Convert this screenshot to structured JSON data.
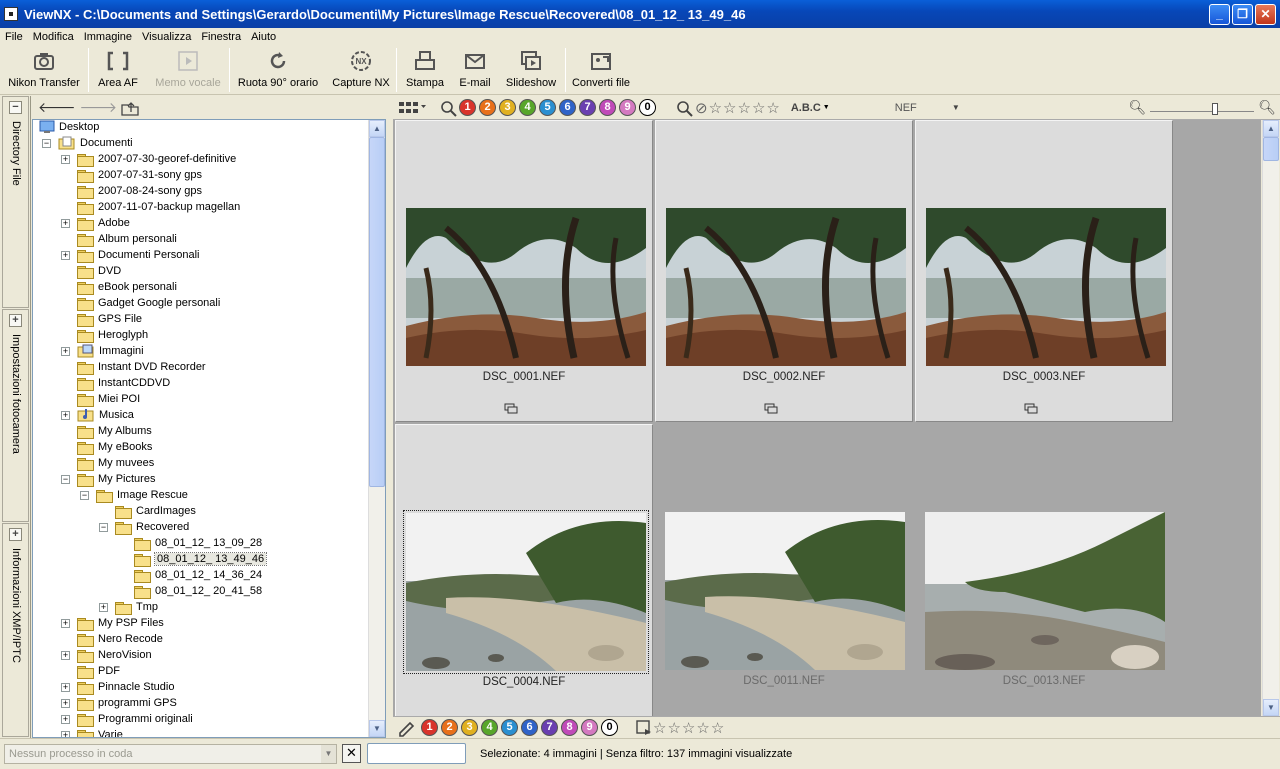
{
  "window": {
    "title": "ViewNX - C:\\Documents and Settings\\Gerardo\\Documenti\\My Pictures\\Image Rescue\\Recovered\\08_01_12_ 13_49_46",
    "buttons": {
      "minimize": "_",
      "maximize": "❐",
      "close": "✕"
    }
  },
  "menu": [
    "File",
    "Modifica",
    "Immagine",
    "Visualizza",
    "Finestra",
    "Aiuto"
  ],
  "toolbar": {
    "nikon_transfer": "Nikon Transfer",
    "area_af": "Area AF",
    "memo_vocale": "Memo vocale",
    "ruota": "Ruota 90° orario",
    "capture_nx": "Capture NX",
    "stampa": "Stampa",
    "email": "E-mail",
    "slideshow": "Slideshow",
    "converti": "Converti file"
  },
  "side_tabs": [
    "Directory File",
    "Impostazioni fotocamera",
    "Informazioni XMP/IPTC"
  ],
  "tree": {
    "rows": [
      {
        "label": "Desktop",
        "level": 0,
        "expander": "",
        "icon": "desktop"
      },
      {
        "label": "Documenti",
        "level": 1,
        "expander": "−",
        "icon": "docs"
      },
      {
        "label": "2007-07-30-georef-definitive",
        "level": 2,
        "expander": "+",
        "icon": "folder"
      },
      {
        "label": "2007-07-31-sony gps",
        "level": 2,
        "expander": "",
        "icon": "folder"
      },
      {
        "label": "2007-08-24-sony gps",
        "level": 2,
        "expander": "",
        "icon": "folder"
      },
      {
        "label": "2007-11-07-backup magellan",
        "level": 2,
        "expander": "",
        "icon": "folder"
      },
      {
        "label": "Adobe",
        "level": 2,
        "expander": "+",
        "icon": "folder"
      },
      {
        "label": "Album personali",
        "level": 2,
        "expander": "",
        "icon": "folder"
      },
      {
        "label": "Documenti Personali",
        "level": 2,
        "expander": "+",
        "icon": "folder"
      },
      {
        "label": "DVD",
        "level": 2,
        "expander": "",
        "icon": "folder"
      },
      {
        "label": "eBook personali",
        "level": 2,
        "expander": "",
        "icon": "folder"
      },
      {
        "label": "Gadget Google personali",
        "level": 2,
        "expander": "",
        "icon": "folder"
      },
      {
        "label": "GPS File",
        "level": 2,
        "expander": "",
        "icon": "folder"
      },
      {
        "label": "Heroglyph",
        "level": 2,
        "expander": "",
        "icon": "folder"
      },
      {
        "label": "Immagini",
        "level": 2,
        "expander": "+",
        "icon": "pictures"
      },
      {
        "label": "Instant DVD Recorder",
        "level": 2,
        "expander": "",
        "icon": "folder"
      },
      {
        "label": "InstantCDDVD",
        "level": 2,
        "expander": "",
        "icon": "folder"
      },
      {
        "label": "Miei POI",
        "level": 2,
        "expander": "",
        "icon": "folder"
      },
      {
        "label": "Musica",
        "level": 2,
        "expander": "+",
        "icon": "music"
      },
      {
        "label": "My Albums",
        "level": 2,
        "expander": "",
        "icon": "folder"
      },
      {
        "label": "My eBooks",
        "level": 2,
        "expander": "",
        "icon": "folder"
      },
      {
        "label": "My muvees",
        "level": 2,
        "expander": "",
        "icon": "folder"
      },
      {
        "label": "My Pictures",
        "level": 2,
        "expander": "−",
        "icon": "folder"
      },
      {
        "label": "Image Rescue",
        "level": 3,
        "expander": "−",
        "icon": "folder"
      },
      {
        "label": "CardImages",
        "level": 4,
        "expander": "",
        "icon": "folder"
      },
      {
        "label": "Recovered",
        "level": 4,
        "expander": "−",
        "icon": "folder"
      },
      {
        "label": "08_01_12_ 13_09_28",
        "level": 5,
        "expander": "",
        "icon": "folder"
      },
      {
        "label": "08_01_12_ 13_49_46",
        "level": 5,
        "expander": "",
        "icon": "folder",
        "selected": true
      },
      {
        "label": "08_01_12_ 14_36_24",
        "level": 5,
        "expander": "",
        "icon": "folder"
      },
      {
        "label": "08_01_12_ 20_41_58",
        "level": 5,
        "expander": "",
        "icon": "folder"
      },
      {
        "label": "Tmp",
        "level": 4,
        "expander": "+",
        "icon": "folder"
      },
      {
        "label": "My PSP Files",
        "level": 2,
        "expander": "+",
        "icon": "folder"
      },
      {
        "label": "Nero Recode",
        "level": 2,
        "expander": "",
        "icon": "folder"
      },
      {
        "label": "NeroVision",
        "level": 2,
        "expander": "+",
        "icon": "folder"
      },
      {
        "label": "PDF",
        "level": 2,
        "expander": "",
        "icon": "folder"
      },
      {
        "label": "Pinnacle Studio",
        "level": 2,
        "expander": "+",
        "icon": "folder"
      },
      {
        "label": "programmi GPS",
        "level": 2,
        "expander": "+",
        "icon": "folder"
      },
      {
        "label": "Programmi originali",
        "level": 2,
        "expander": "+",
        "icon": "folder"
      },
      {
        "label": "Varie",
        "level": 2,
        "expander": "+",
        "icon": "folder"
      }
    ]
  },
  "filterbar": {
    "labels": [
      "1",
      "2",
      "3",
      "4",
      "5",
      "6",
      "7",
      "8",
      "9",
      "0"
    ],
    "label_colors": [
      "#d9342b",
      "#e8701a",
      "#e0b020",
      "#58a62a",
      "#2a8fd0",
      "#2f63c8",
      "#6a3fb0",
      "#c04ab8",
      "#d479c0",
      "#ffffff"
    ],
    "text_sort": "A.B.C",
    "format": "NEF"
  },
  "thumbnails": [
    {
      "name": "DSC_0001.NEF",
      "scene": "forest",
      "dimmed": false,
      "selected": false
    },
    {
      "name": "DSC_0002.NEF",
      "scene": "forest",
      "dimmed": false,
      "selected": false
    },
    {
      "name": "DSC_0003.NEF",
      "scene": "forest",
      "dimmed": false,
      "selected": false
    },
    {
      "name": "DSC_0004.NEF",
      "scene": "coast",
      "dimmed": false,
      "selected": true
    },
    {
      "name": "DSC_0011.NEF",
      "scene": "coast",
      "dimmed": true,
      "selected": false
    },
    {
      "name": "DSC_0013.NEF",
      "scene": "coast2",
      "dimmed": true,
      "selected": false
    }
  ],
  "status": {
    "queue": "Nessun processo in coda",
    "close_btn": "✕",
    "text": "Selezionate: 4 immagini | Senza filtro: 137 immagini visualizzate"
  }
}
